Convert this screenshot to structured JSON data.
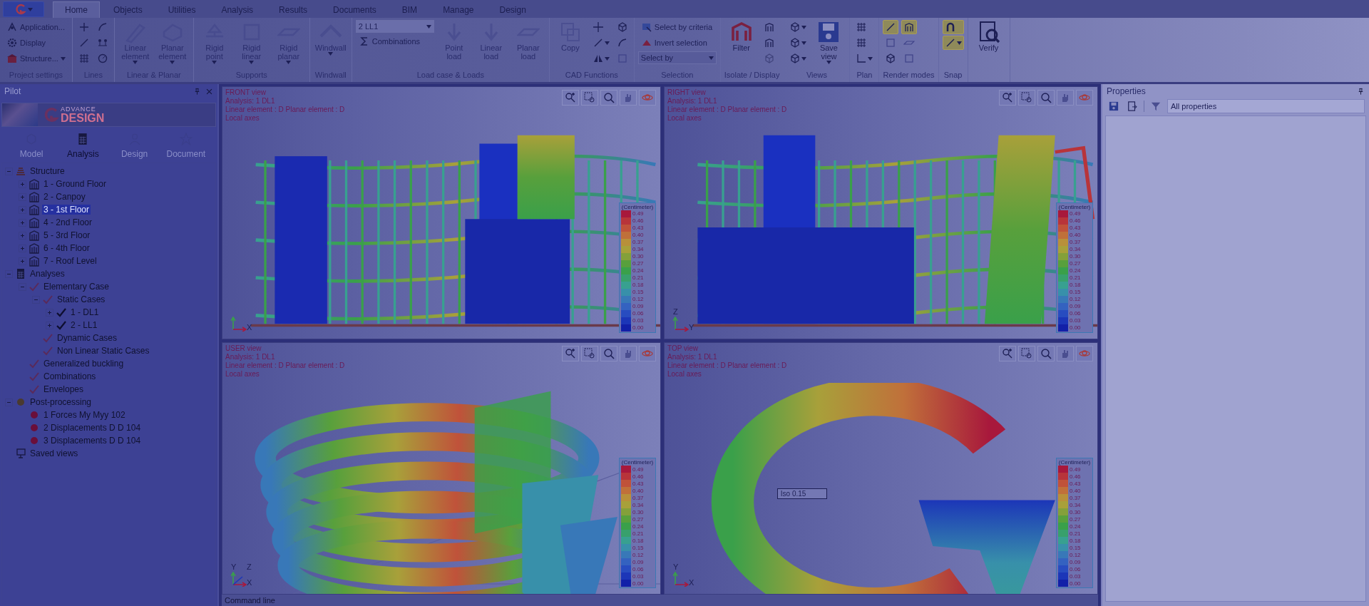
{
  "ribbon": {
    "tabs": [
      {
        "label": "Home",
        "selected": true
      },
      {
        "label": "Objects",
        "selected": false
      },
      {
        "label": "Utilities",
        "selected": false
      },
      {
        "label": "Analysis",
        "selected": false
      },
      {
        "label": "Results",
        "selected": false
      },
      {
        "label": "Documents",
        "selected": false
      },
      {
        "label": "BIM",
        "selected": false
      },
      {
        "label": "Manage",
        "selected": false
      },
      {
        "label": "Design",
        "selected": false
      }
    ],
    "groups": [
      {
        "title": "Project settings",
        "items": [
          {
            "kind": "small",
            "label": "Application...",
            "disabled": false
          },
          {
            "kind": "small",
            "label": "Display",
            "disabled": false
          },
          {
            "kind": "small",
            "label": "Structure...",
            "disabled": false,
            "menu": true
          }
        ]
      },
      {
        "title": "Lines",
        "items": [
          {
            "kind": "icon",
            "disabled": false
          },
          {
            "kind": "icon",
            "disabled": false
          },
          {
            "kind": "icon",
            "disabled": false
          },
          {
            "kind": "icon",
            "disabled": false
          },
          {
            "kind": "icon",
            "disabled": false
          },
          {
            "kind": "icon",
            "disabled": false
          }
        ]
      },
      {
        "title": "Linear & Planar",
        "items": [
          {
            "kind": "large",
            "label": "Linear element",
            "disabled": true,
            "menu": true
          },
          {
            "kind": "large",
            "label": "Planar element",
            "disabled": true,
            "menu": true
          }
        ]
      },
      {
        "title": "Supports",
        "items": [
          {
            "kind": "large",
            "label": "Rigid point",
            "disabled": true,
            "menu": true
          },
          {
            "kind": "large",
            "label": "Rigid linear",
            "disabled": true,
            "menu": true
          },
          {
            "kind": "large",
            "label": "Rigid planar",
            "disabled": true,
            "menu": true
          }
        ]
      },
      {
        "title": "Windwall",
        "items": [
          {
            "kind": "large",
            "label": "Windwall",
            "disabled": true,
            "menu": true
          }
        ]
      },
      {
        "title": "Load case & Loads",
        "items": [
          {
            "kind": "dropdown",
            "label": "2 LL1",
            "disabled": true
          },
          {
            "kind": "small",
            "label": "Combinations",
            "disabled": false
          },
          {
            "kind": "large",
            "label": "Point load",
            "disabled": true
          },
          {
            "kind": "large",
            "label": "Linear load",
            "disabled": true
          },
          {
            "kind": "large",
            "label": "Planar load",
            "disabled": true
          }
        ]
      },
      {
        "title": "CAD Functions",
        "items": [
          {
            "kind": "large",
            "label": "Copy",
            "disabled": true
          },
          {
            "kind": "icon",
            "disabled": false
          },
          {
            "kind": "icon",
            "disabled": false,
            "menu": true
          },
          {
            "kind": "icon",
            "disabled": false,
            "menu": true
          },
          {
            "kind": "icon",
            "disabled": false
          },
          {
            "kind": "icon",
            "disabled": false
          },
          {
            "kind": "icon",
            "disabled": false
          }
        ]
      },
      {
        "title": "Selection",
        "items": [
          {
            "kind": "small",
            "label": "Select by criteria",
            "disabled": false
          },
          {
            "kind": "small",
            "label": "Invert selection",
            "disabled": false
          },
          {
            "kind": "dropdown",
            "label": "Select by",
            "disabled": false
          }
        ]
      },
      {
        "title": "Isolate / Display",
        "items": [
          {
            "kind": "large",
            "label": "Filter",
            "disabled": false
          },
          {
            "kind": "icon",
            "disabled": false
          },
          {
            "kind": "icon",
            "disabled": false
          },
          {
            "kind": "icon",
            "disabled": true
          }
        ]
      },
      {
        "title": "Views",
        "items": [
          {
            "kind": "icon",
            "disabled": false,
            "menu": true
          },
          {
            "kind": "icon",
            "disabled": false,
            "menu": true
          },
          {
            "kind": "icon",
            "disabled": false,
            "menu": true
          },
          {
            "kind": "large",
            "label": "Save view",
            "disabled": false,
            "menu": true
          }
        ]
      },
      {
        "title": "Plan",
        "items": [
          {
            "kind": "icon",
            "disabled": false
          },
          {
            "kind": "icon",
            "disabled": false
          },
          {
            "kind": "icon",
            "disabled": false,
            "menu": true
          }
        ]
      },
      {
        "title": "Render modes",
        "items": [
          {
            "kind": "toggle",
            "selected": true,
            "disabled": false
          },
          {
            "kind": "toggle",
            "selected": false,
            "disabled": false
          },
          {
            "kind": "toggle",
            "selected": false,
            "disabled": false
          },
          {
            "kind": "toggle",
            "selected": true,
            "disabled": false
          },
          {
            "kind": "toggle",
            "selected": false,
            "disabled": false
          },
          {
            "kind": "toggle",
            "selected": false,
            "disabled": false
          }
        ]
      },
      {
        "title": "Snap",
        "items": [
          {
            "kind": "toggle",
            "selected": true,
            "disabled": false
          },
          {
            "kind": "toggle",
            "selected": true,
            "disabled": false,
            "menu": true
          }
        ]
      },
      {
        "items": [
          {
            "kind": "large",
            "label": "Verify",
            "disabled": false
          }
        ]
      }
    ]
  },
  "pilot": {
    "title": "Pilot",
    "logo": {
      "top": "ADVANCE",
      "bottom": "DESIGN"
    },
    "tabs": [
      {
        "label": "Model",
        "selected": false
      },
      {
        "label": "Analysis",
        "selected": true
      },
      {
        "label": "Design",
        "selected": false
      },
      {
        "label": "Document",
        "selected": false
      }
    ],
    "tree": [
      {
        "label": "Structure",
        "kind": "stack",
        "expanded": true,
        "selected": false,
        "children": [
          {
            "label": "1 - Ground Floor",
            "kind": "level",
            "expanded": false,
            "selected": false
          },
          {
            "label": "2 - Canpoy",
            "kind": "level",
            "expanded": false,
            "selected": false
          },
          {
            "label": "3 - 1st Floor",
            "kind": "level",
            "expanded": false,
            "selected": true
          },
          {
            "label": "4 - 2nd Floor",
            "kind": "level",
            "expanded": false,
            "selected": false
          },
          {
            "label": "5 - 3rd Floor",
            "kind": "level",
            "expanded": false,
            "selected": false
          },
          {
            "label": "6 - 4th Floor",
            "kind": "level",
            "expanded": false,
            "selected": false
          },
          {
            "label": "7 - Roof Level",
            "kind": "level",
            "expanded": false,
            "selected": false
          }
        ]
      },
      {
        "label": "Analyses",
        "kind": "calc",
        "expanded": true,
        "selected": false,
        "children": [
          {
            "label": "Elementary Case",
            "kind": "check",
            "expanded": true,
            "selected": false,
            "children": [
              {
                "label": "Static Cases",
                "kind": "check",
                "expanded": true,
                "selected": false,
                "children": [
                  {
                    "label": "1 - DL1",
                    "kind": "done",
                    "expanded": false,
                    "selected": false
                  },
                  {
                    "label": "2 - LL1",
                    "kind": "done",
                    "expanded": false,
                    "selected": false
                  }
                ]
              },
              {
                "label": "Dynamic Cases",
                "kind": "check",
                "selected": false
              },
              {
                "label": "Non Linear Static Cases",
                "kind": "check",
                "selected": false
              }
            ]
          },
          {
            "label": "Generalized buckling",
            "kind": "check",
            "selected": false
          },
          {
            "label": "Combinations",
            "kind": "check",
            "selected": false
          },
          {
            "label": "Envelopes",
            "kind": "check",
            "selected": false
          }
        ]
      },
      {
        "label": "Post-processing",
        "kind": "post",
        "expanded": true,
        "selected": false,
        "children": [
          {
            "label": "1 Forces My  Myy  102",
            "kind": "dot",
            "selected": false
          },
          {
            "label": "2 Displacements D  D  104",
            "kind": "dot",
            "selected": false
          },
          {
            "label": "3 Displacements D  D  104",
            "kind": "dot",
            "selected": false
          }
        ]
      },
      {
        "label": "Saved views",
        "kind": "views",
        "selected": false
      }
    ]
  },
  "viewports": [
    {
      "kind": "front",
      "title": "FRONT view",
      "lines": [
        "Analysis: 1  DL1",
        "Linear element : D Planar element : D",
        "Local axes"
      ],
      "axes": [
        {
          "label": "X",
          "kind": "right"
        }
      ],
      "legend": {
        "unit": "(Centimeter)",
        "entries": [
          {
            "value": "0.49",
            "color": "#a8183c"
          },
          {
            "value": "0.46",
            "color": "#b8343a"
          },
          {
            "value": "0.43",
            "color": "#c0523a"
          },
          {
            "value": "0.40",
            "color": "#c0703a"
          },
          {
            "value": "0.37",
            "color": "#b8903a"
          },
          {
            "value": "0.34",
            "color": "#a8a03a"
          },
          {
            "value": "0.30",
            "color": "#84a03a"
          },
          {
            "value": "0.27",
            "color": "#58a03c"
          },
          {
            "value": "0.24",
            "color": "#3aa04a"
          },
          {
            "value": "0.21",
            "color": "#38a06c"
          },
          {
            "value": "0.18",
            "color": "#38a090"
          },
          {
            "value": "0.15",
            "color": "#3890aa"
          },
          {
            "value": "0.12",
            "color": "#3878b8"
          },
          {
            "value": "0.09",
            "color": "#3462c0"
          },
          {
            "value": "0.06",
            "color": "#284cc0"
          },
          {
            "value": "0.03",
            "color": "#1c36b8"
          },
          {
            "value": "0.00",
            "color": "#1220a8"
          }
        ]
      }
    },
    {
      "kind": "right",
      "title": "RIGHT view",
      "lines": [
        "Analysis: 1  DL1",
        "Linear element : D Planar element : D",
        "Local axes"
      ],
      "axes": [
        {
          "label": "Z",
          "kind": "up"
        },
        {
          "label": "Y",
          "kind": "right"
        }
      ],
      "legend": {
        "unit": "(Centimeter)",
        "entries": [
          {
            "value": "0.49",
            "color": "#a8183c"
          },
          {
            "value": "0.46",
            "color": "#b8343a"
          },
          {
            "value": "0.43",
            "color": "#c0523a"
          },
          {
            "value": "0.40",
            "color": "#c0703a"
          },
          {
            "value": "0.37",
            "color": "#b8903a"
          },
          {
            "value": "0.34",
            "color": "#a8a03a"
          },
          {
            "value": "0.30",
            "color": "#84a03a"
          },
          {
            "value": "0.27",
            "color": "#58a03c"
          },
          {
            "value": "0.24",
            "color": "#3aa04a"
          },
          {
            "value": "0.21",
            "color": "#38a06c"
          },
          {
            "value": "0.18",
            "color": "#38a090"
          },
          {
            "value": "0.15",
            "color": "#3890aa"
          },
          {
            "value": "0.12",
            "color": "#3878b8"
          },
          {
            "value": "0.09",
            "color": "#3462c0"
          },
          {
            "value": "0.06",
            "color": "#284cc0"
          },
          {
            "value": "0.03",
            "color": "#1c36b8"
          },
          {
            "value": "0.00",
            "color": "#1220a8"
          }
        ]
      }
    },
    {
      "kind": "user",
      "title": "USER view",
      "lines": [
        "Analysis: 1  DL1",
        "Linear element : D Planar element : D",
        "Local axes"
      ],
      "axes": [
        {
          "label": "Z",
          "kind": "diag"
        },
        {
          "label": "Y",
          "kind": "up"
        },
        {
          "label": "X",
          "kind": "right"
        }
      ],
      "legend": {
        "unit": "(Centimeter)",
        "entries": [
          {
            "value": "0.49",
            "color": "#a8183c"
          },
          {
            "value": "0.46",
            "color": "#b8343a"
          },
          {
            "value": "0.43",
            "color": "#c0523a"
          },
          {
            "value": "0.40",
            "color": "#c0703a"
          },
          {
            "value": "0.37",
            "color": "#b8903a"
          },
          {
            "value": "0.34",
            "color": "#a8a03a"
          },
          {
            "value": "0.30",
            "color": "#84a03a"
          },
          {
            "value": "0.27",
            "color": "#58a03c"
          },
          {
            "value": "0.24",
            "color": "#3aa04a"
          },
          {
            "value": "0.21",
            "color": "#38a06c"
          },
          {
            "value": "0.18",
            "color": "#38a090"
          },
          {
            "value": "0.15",
            "color": "#3890aa"
          },
          {
            "value": "0.12",
            "color": "#3878b8"
          },
          {
            "value": "0.09",
            "color": "#3462c0"
          },
          {
            "value": "0.06",
            "color": "#284cc0"
          },
          {
            "value": "0.03",
            "color": "#1c36b8"
          },
          {
            "value": "0.00",
            "color": "#1220a8"
          }
        ]
      }
    },
    {
      "kind": "top",
      "title": "TOP view",
      "lines": [
        "Analysis: 1  DL1",
        "Linear element : D Planar element : D",
        "Local axes"
      ],
      "axes": [
        {
          "label": "Y",
          "kind": "up"
        },
        {
          "label": "X",
          "kind": "right"
        }
      ],
      "annotation": "Iso 0.15",
      "legend": {
        "unit": "(Centimeter)",
        "entries": [
          {
            "value": "0.49",
            "color": "#a8183c"
          },
          {
            "value": "0.46",
            "color": "#b8343a"
          },
          {
            "value": "0.43",
            "color": "#c0523a"
          },
          {
            "value": "0.40",
            "color": "#c0703a"
          },
          {
            "value": "0.37",
            "color": "#b8903a"
          },
          {
            "value": "0.34",
            "color": "#a8a03a"
          },
          {
            "value": "0.30",
            "color": "#84a03a"
          },
          {
            "value": "0.27",
            "color": "#58a03c"
          },
          {
            "value": "0.24",
            "color": "#3aa04a"
          },
          {
            "value": "0.21",
            "color": "#38a06c"
          },
          {
            "value": "0.18",
            "color": "#38a090"
          },
          {
            "value": "0.15",
            "color": "#3890aa"
          },
          {
            "value": "0.12",
            "color": "#3878b8"
          },
          {
            "value": "0.09",
            "color": "#3462c0"
          },
          {
            "value": "0.06",
            "color": "#284cc0"
          },
          {
            "value": "0.03",
            "color": "#1c36b8"
          },
          {
            "value": "0.00",
            "color": "#1220a8"
          }
        ]
      }
    }
  ],
  "command_line": {
    "title": "Command line"
  },
  "properties": {
    "title": "Properties",
    "filter": "All properties"
  }
}
